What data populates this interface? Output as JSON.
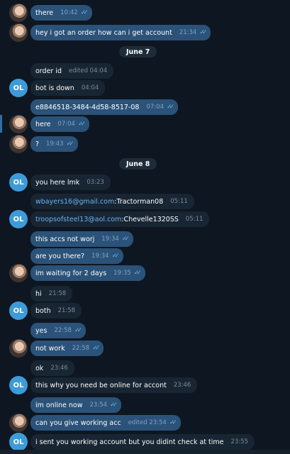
{
  "dates": [
    "June 7",
    "June 8"
  ],
  "avatar_initials": "OL",
  "messages": [
    {
      "text": "there",
      "time": "10:42",
      "dir": "out",
      "read": true
    },
    {
      "text": "hey i got an order how can i get account",
      "time": "21:34",
      "dir": "out",
      "read": true
    },
    {
      "text": "order id",
      "time": "edited 04:04",
      "dir": "in"
    },
    {
      "text": "bot is down",
      "time": "04:04",
      "dir": "in"
    },
    {
      "text": "e8846518-3484-4d58-8517-08",
      "time": "07:04",
      "dir": "out",
      "read": true
    },
    {
      "text": "here",
      "time": "07:04",
      "dir": "out",
      "read": true
    },
    {
      "text": "?",
      "time": "19:43",
      "dir": "out",
      "read": true
    },
    {
      "text": "you here lmk",
      "time": "03:23",
      "dir": "in"
    },
    {
      "link": "wbayers16@gmail.com",
      "text": ":Tractorman08",
      "time": "05:11",
      "dir": "in"
    },
    {
      "link": "troopsofsteel13@aol.com",
      "text": ":Chevelle1320SS",
      "time": "05:11",
      "dir": "in"
    },
    {
      "text": "this accs not worj",
      "time": "19:34",
      "dir": "out",
      "read": true
    },
    {
      "text": "are you there?",
      "time": "19:34",
      "dir": "out",
      "read": true
    },
    {
      "text": "im waiting for 2 days",
      "time": "19:35",
      "dir": "out",
      "read": true
    },
    {
      "text": "hi",
      "time": "21:58",
      "dir": "in"
    },
    {
      "text": "both",
      "time": "21:58",
      "dir": "in"
    },
    {
      "text": "yes",
      "time": "22:58",
      "dir": "out",
      "read": true
    },
    {
      "text": "not work",
      "time": "22:58",
      "dir": "out",
      "read": true
    },
    {
      "text": "ok",
      "time": "23:46",
      "dir": "in"
    },
    {
      "text": "this why you need be online for accont",
      "time": "23:46",
      "dir": "in"
    },
    {
      "text": "im online now",
      "time": "23:54",
      "dir": "out",
      "read": true
    },
    {
      "text": "can you give working acc",
      "time": "edited 23:54",
      "dir": "out",
      "read": true
    },
    {
      "text": "i sent you working account but you didint check at time",
      "time": "23:55",
      "dir": "in"
    }
  ],
  "colors": {
    "background": "#0e1621",
    "outgoing_bubble": "#2b5278",
    "incoming_bubble": "#182533",
    "link": "#6ab3f3",
    "avatar": "#3d9bd8"
  },
  "icons": {
    "read_receipt": "double-check-icon",
    "user_avatar": "profile-photo",
    "contact_avatar": "initials-avatar"
  }
}
